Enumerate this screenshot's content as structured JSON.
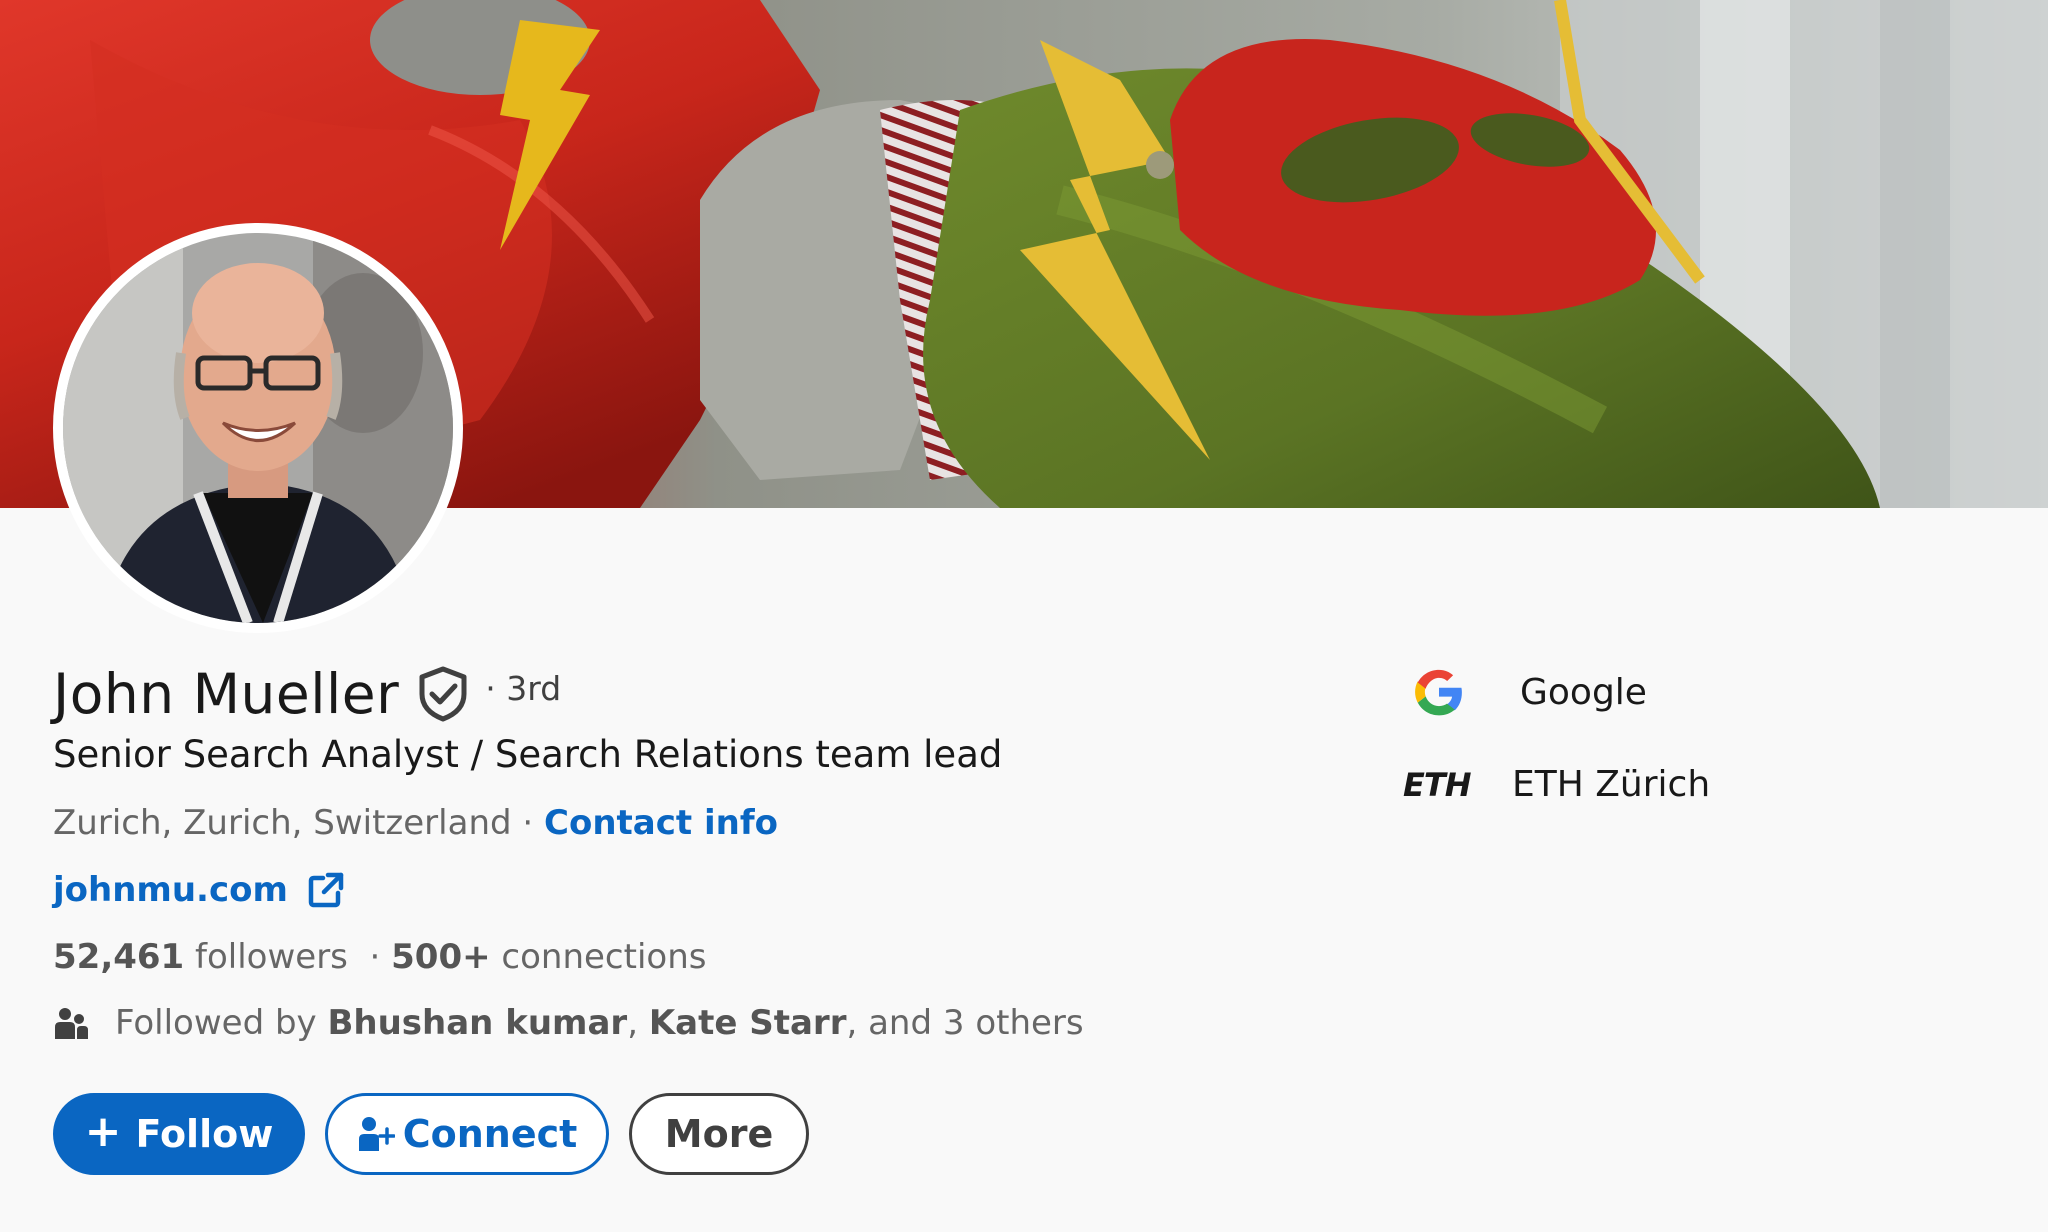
{
  "profile": {
    "name": "John Mueller",
    "degree": "· 3rd",
    "headline": "Senior Search Analyst / Search Relations team lead",
    "location": "Zurich, Zurich, Switzerland",
    "separator": " · ",
    "contact_info": "Contact info",
    "website": "johnmu.com",
    "followers_count": "52,461",
    "followers_label": " followers",
    "connections_prefix": "  · ",
    "connections_count": "500+",
    "connections_label": " connections",
    "followed_by": {
      "prefix": "Followed by ",
      "person1": "Bhushan kumar",
      "comma": ", ",
      "person2": "Kate Starr",
      "suffix": ", and 3 others"
    }
  },
  "buttons": {
    "follow": "Follow",
    "connect": "Connect",
    "more": "More"
  },
  "organizations": [
    {
      "name": "Google",
      "logo": "google-logo"
    },
    {
      "name": "ETH Zürich",
      "logo_text": "ETH"
    }
  ],
  "colors": {
    "linkedin_blue": "#0a66c2",
    "text_primary": "#191919",
    "text_secondary": "#666666"
  },
  "icons": {
    "verified": "shield-check-icon",
    "external_link": "external-link-icon",
    "people": "people-icon",
    "connect": "add-person-icon"
  }
}
